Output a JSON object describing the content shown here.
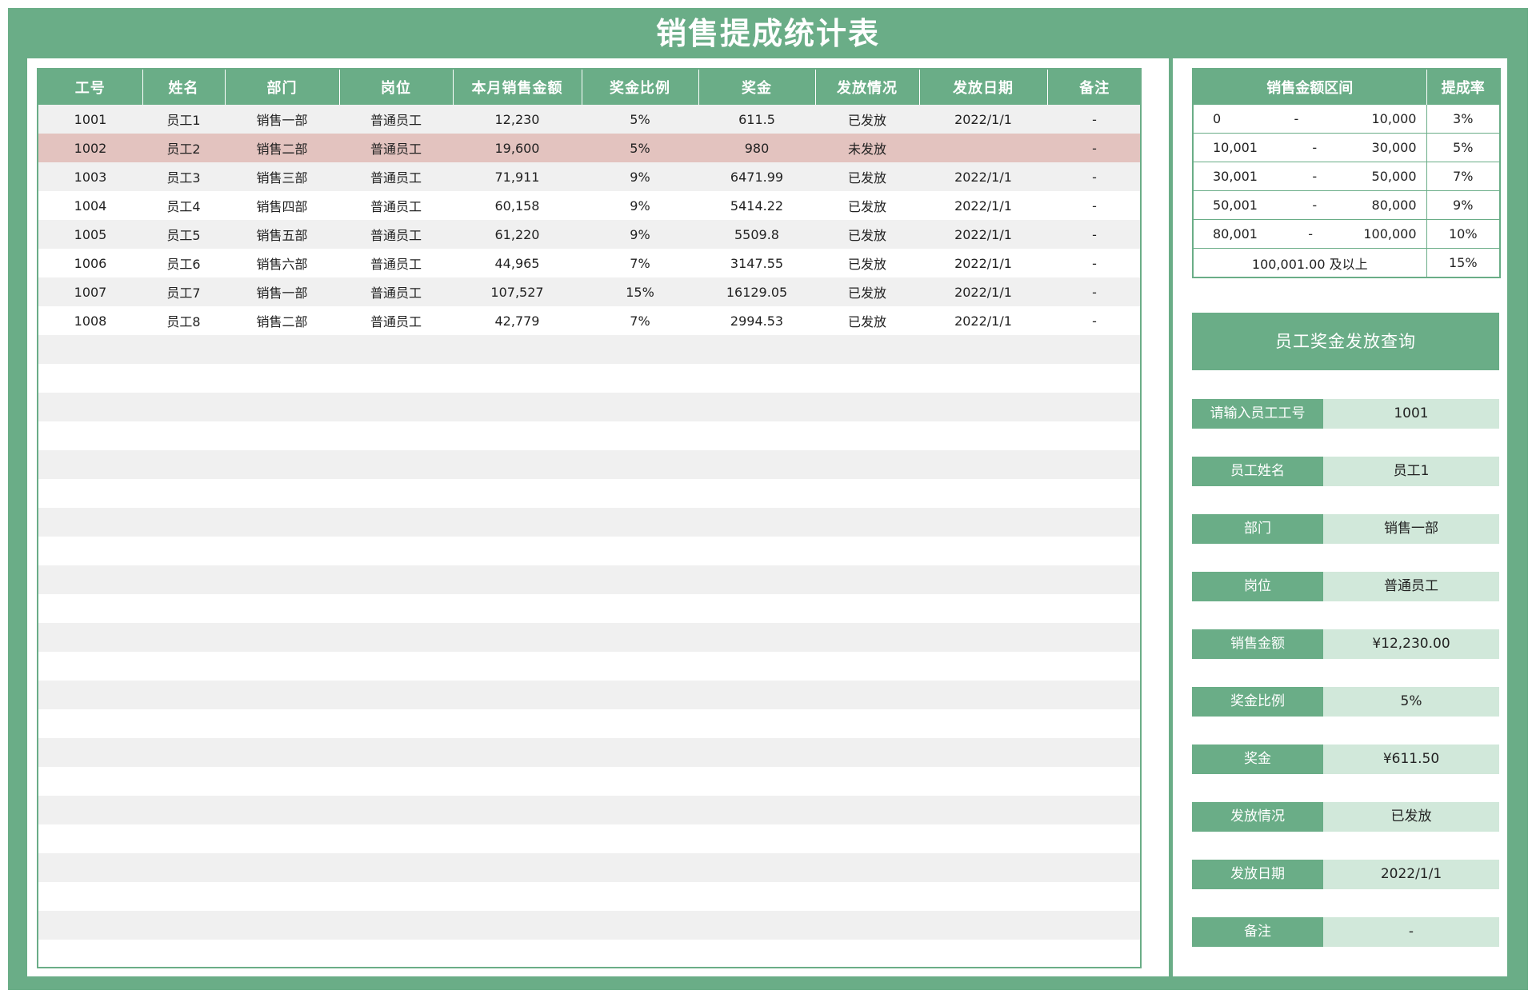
{
  "title": "销售提成统计表",
  "main_table": {
    "headers": [
      "工号",
      "姓名",
      "部门",
      "岗位",
      "本月销售金额",
      "奖金比例",
      "奖金",
      "发放情况",
      "发放日期",
      "备注"
    ],
    "rows": [
      [
        "1001",
        "员工1",
        "销售一部",
        "普通员工",
        "12,230",
        "5%",
        "611.5",
        "已发放",
        "2022/1/1",
        "-"
      ],
      [
        "1002",
        "员工2",
        "销售二部",
        "普通员工",
        "19,600",
        "5%",
        "980",
        "未发放",
        "",
        "-"
      ],
      [
        "1003",
        "员工3",
        "销售三部",
        "普通员工",
        "71,911",
        "9%",
        "6471.99",
        "已发放",
        "2022/1/1",
        "-"
      ],
      [
        "1004",
        "员工4",
        "销售四部",
        "普通员工",
        "60,158",
        "9%",
        "5414.22",
        "已发放",
        "2022/1/1",
        "-"
      ],
      [
        "1005",
        "员工5",
        "销售五部",
        "普通员工",
        "61,220",
        "9%",
        "5509.8",
        "已发放",
        "2022/1/1",
        "-"
      ],
      [
        "1006",
        "员工6",
        "销售六部",
        "普通员工",
        "44,965",
        "7%",
        "3147.55",
        "已发放",
        "2022/1/1",
        "-"
      ],
      [
        "1007",
        "员工7",
        "销售一部",
        "普通员工",
        "107,527",
        "15%",
        "16129.05",
        "已发放",
        "2022/1/1",
        "-"
      ],
      [
        "1008",
        "员工8",
        "销售二部",
        "普通员工",
        "42,779",
        "7%",
        "2994.53",
        "已发放",
        "2022/1/1",
        "-"
      ]
    ]
  },
  "rate_table": {
    "headers": [
      "销售金额区间",
      "提成率"
    ],
    "rows": [
      {
        "low": "0",
        "sep": "-",
        "high": "10,000",
        "rate": "3%"
      },
      {
        "low": "10,001",
        "sep": "-",
        "high": "30,000",
        "rate": "5%"
      },
      {
        "low": "30,001",
        "sep": "-",
        "high": "50,000",
        "rate": "7%"
      },
      {
        "low": "50,001",
        "sep": "-",
        "high": "80,000",
        "rate": "9%"
      },
      {
        "low": "80,001",
        "sep": "-",
        "high": "100,000",
        "rate": "10%"
      }
    ],
    "last_row": {
      "range": "100,001.00 及以上",
      "rate": "15%"
    }
  },
  "query": {
    "header": "员工奖金发放查询",
    "fields": [
      {
        "label": "请输入员工工号",
        "value": "1001"
      },
      {
        "label": "员工姓名",
        "value": "员工1"
      },
      {
        "label": "部门",
        "value": "销售一部"
      },
      {
        "label": "岗位",
        "value": "普通员工"
      },
      {
        "label": "销售金额",
        "value": "¥12,230.00"
      },
      {
        "label": "奖金比例",
        "value": "5%"
      },
      {
        "label": "奖金",
        "value": "¥611.50"
      },
      {
        "label": "发放情况",
        "value": "已发放"
      },
      {
        "label": "发放日期",
        "value": "2022/1/1"
      },
      {
        "label": "备注",
        "value": "-"
      }
    ]
  },
  "colors": {
    "accent": "#6aad87",
    "value_bg": "#d1e8da",
    "highlight_row": "#e3c3bf",
    "stripe": "#f0f0f0"
  }
}
